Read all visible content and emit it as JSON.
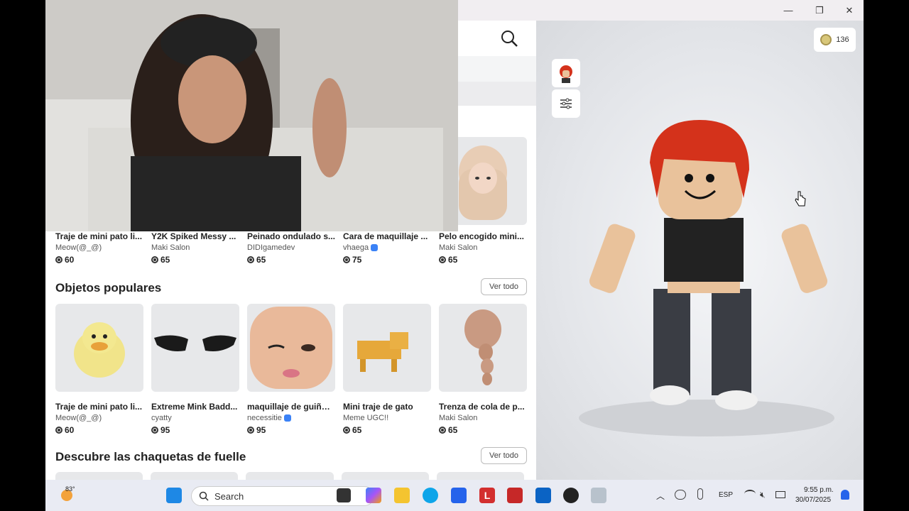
{
  "window": {
    "minimize_glyph": "—",
    "maximize_glyph": "❐",
    "close_glyph": "✕"
  },
  "header": {
    "robux_balance": "136"
  },
  "shop": {
    "top_row": [
      {
        "name": "Traje de mini pato li...",
        "creator": "Meow(@_@)",
        "price": "60",
        "verified": false
      },
      {
        "name": "Y2K Spiked Messy ...",
        "creator": "Maki Salon",
        "price": "65",
        "verified": false
      },
      {
        "name": "Peinado ondulado s...",
        "creator": "DIDIgamedev",
        "price": "65",
        "verified": false
      },
      {
        "name": "Cara de maquillaje ...",
        "creator": "vhaega",
        "price": "75",
        "verified": true
      },
      {
        "name": "Pelo encogido mini...",
        "creator": "Maki Salon",
        "price": "65",
        "verified": false
      }
    ],
    "popular": {
      "title": "Objetos populares",
      "see_all": "Ver todo",
      "items": [
        {
          "name": "Traje de mini pato li...",
          "creator": "Meow(@_@)",
          "price": "60",
          "verified": false
        },
        {
          "name": "Extreme Mink Badd...",
          "creator": "cyatty",
          "price": "95",
          "verified": false
        },
        {
          "name": "maquillaje de guiño ...",
          "creator": "necessitie",
          "price": "95",
          "verified": true
        },
        {
          "name": "Mini traje de gato",
          "creator": "Meme UGC!!",
          "price": "65",
          "verified": false
        },
        {
          "name": "Trenza de cola de p...",
          "creator": "Maki Salon",
          "price": "65",
          "verified": false
        }
      ]
    },
    "jackets": {
      "title": "Descubre las chaquetas de fuelle",
      "see_all": "Ver todo"
    }
  },
  "taskbar": {
    "weather_temp": "83°",
    "search_placeholder": "Search",
    "language": "ESP",
    "time": "9:55 p.m.",
    "date": "30/07/2025"
  },
  "colors": {
    "accent_blue": "#3b82f6",
    "hair_red": "#d4321b",
    "taskbar_bg": "#e9ebf3"
  }
}
